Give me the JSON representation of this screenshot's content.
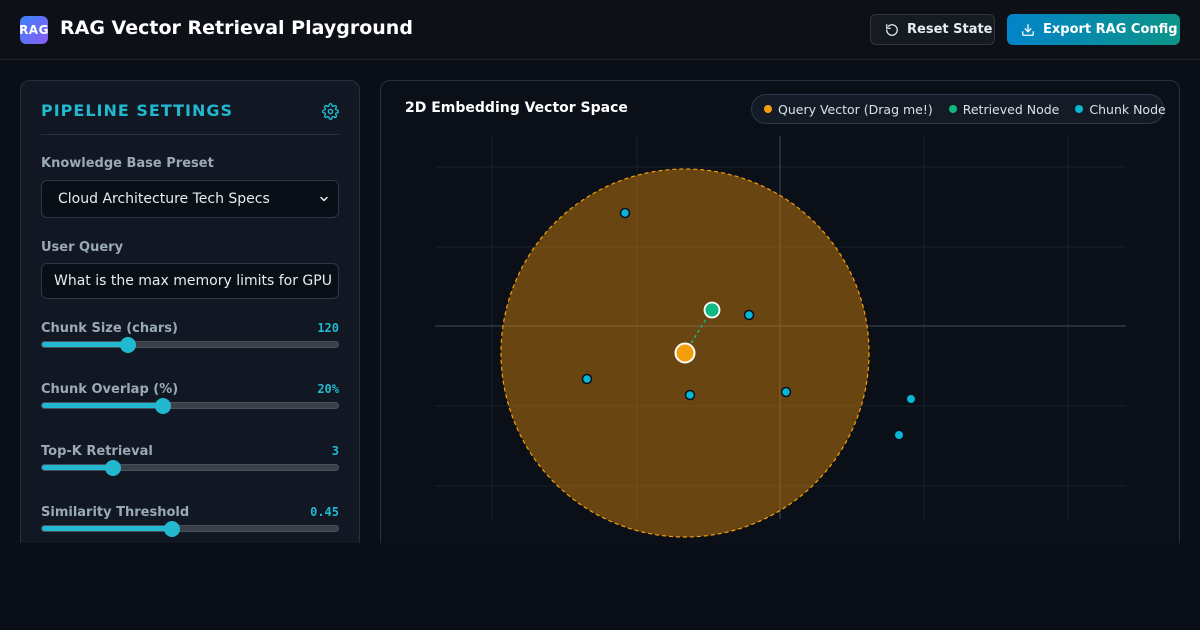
{
  "header": {
    "logo_text": "RAG",
    "title": "RAG Vector Retrieval Playground",
    "reset_label": "Reset State",
    "export_label": "Export RAG Config"
  },
  "settings": {
    "title": "PIPELINE SETTINGS",
    "kb_label": "Knowledge Base Preset",
    "kb_value": "Cloud Architecture Tech Specs",
    "query_label": "User Query",
    "query_value": "What is the max memory limits for GPU",
    "sliders": [
      {
        "label": "Chunk Size (chars)",
        "value": "120",
        "fraction": 0.29
      },
      {
        "label": "Chunk Overlap (%)",
        "value": "20%",
        "fraction": 0.41
      },
      {
        "label": "Top-K Retrieval",
        "value": "3",
        "fraction": 0.24
      },
      {
        "label": "Similarity Threshold",
        "value": "0.45",
        "fraction": 0.44
      }
    ]
  },
  "visualization": {
    "title": "2D Embedding Vector Space",
    "legend": [
      {
        "label": "Query Vector (Drag me!)",
        "color": "#f59e0b"
      },
      {
        "label": "Retrieved Node",
        "color": "#10b981"
      },
      {
        "label": "Chunk Node",
        "color": "#06b6d4"
      }
    ]
  },
  "colors": {
    "accent": "#22b8cf",
    "query": "#f59e0b",
    "retrieved": "#10b981",
    "chunk": "#06b6d4"
  }
}
